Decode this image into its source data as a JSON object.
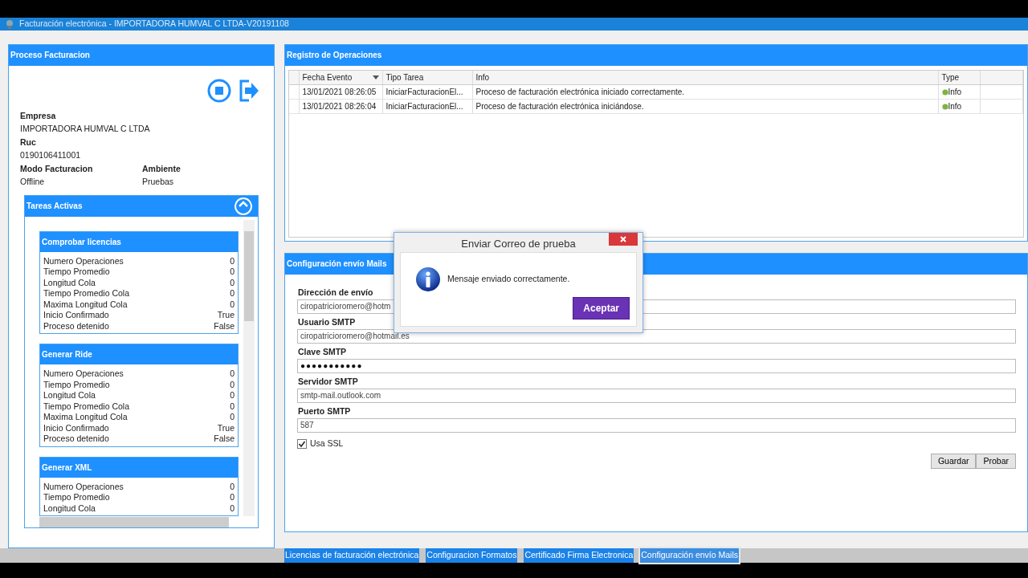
{
  "window": {
    "title": "Facturación electrónica - IMPORTADORA HUMVAL C  LTDA-V20191108"
  },
  "proceso": {
    "title": "Proceso Facturacion",
    "fields": [
      {
        "label": "Empresa",
        "value": "IMPORTADORA HUMVAL C  LTDA"
      },
      {
        "label": "Ruc",
        "value": "0190106411001"
      }
    ],
    "pair_fields": [
      {
        "label": "Modo Facturacion",
        "value": "Offline"
      },
      {
        "label": "Ambiente",
        "value": "Pruebas"
      }
    ],
    "tareas": {
      "title": "Tareas Activas",
      "expanded": true,
      "groups": [
        {
          "title": "Comprobar licencias",
          "rows": [
            {
              "label": "Numero Operaciones",
              "value": "0"
            },
            {
              "label": "Tiempo Promedio",
              "value": "0"
            },
            {
              "label": "Longitud Cola",
              "value": "0"
            },
            {
              "label": "Tiempo Promedio Cola",
              "value": "0"
            },
            {
              "label": "Maxima Longitud Cola",
              "value": "0"
            },
            {
              "label": "Inicio Confirmado",
              "value": "True"
            },
            {
              "label": "Proceso detenido",
              "value": "False"
            }
          ]
        },
        {
          "title": "Generar Ride",
          "rows": [
            {
              "label": "Numero Operaciones",
              "value": "0"
            },
            {
              "label": "Tiempo Promedio",
              "value": "0"
            },
            {
              "label": "Longitud Cola",
              "value": "0"
            },
            {
              "label": "Tiempo Promedio Cola",
              "value": "0"
            },
            {
              "label": "Maxima Longitud Cola",
              "value": "0"
            },
            {
              "label": "Inicio Confirmado",
              "value": "True"
            },
            {
              "label": "Proceso detenido",
              "value": "False"
            }
          ]
        },
        {
          "title": "Generar XML",
          "rows": [
            {
              "label": "Numero Operaciones",
              "value": "0"
            },
            {
              "label": "Tiempo Promedio",
              "value": "0"
            },
            {
              "label": "Longitud Cola",
              "value": "0"
            }
          ]
        }
      ]
    }
  },
  "registro": {
    "title": "Registro de Operaciones",
    "table": {
      "columns": [
        {
          "label": "Fecha Evento",
          "sorted": true
        },
        {
          "label": "Tipo Tarea",
          "sorted": false
        },
        {
          "label": "Info",
          "sorted": false
        },
        {
          "label": "Type",
          "sorted": false
        }
      ],
      "rows": [
        [
          "13/01/2021 08:26:05",
          "IniciarFacturacionEl...",
          "Proceso de facturación electrónica iniciado correctamente.",
          "Info"
        ],
        [
          "13/01/2021 08:26:04",
          "IniciarFacturacionEl...",
          "Proceso de facturación electrónica iniciándose.",
          "Info"
        ]
      ]
    }
  },
  "config": {
    "title": "Configuración envío Mails",
    "fields": [
      {
        "label": "Dirección de envío",
        "value": "ciropatricioromero@hotm",
        "kind": "text"
      },
      {
        "label": "Usuario SMTP",
        "value": "ciropatricioromero@hotmail.es",
        "kind": "text"
      },
      {
        "label": "Clave SMTP",
        "value": "●●●●●●●●●●●",
        "kind": "password"
      },
      {
        "label": "Servidor SMTP",
        "value": "smtp-mail.outlook.com",
        "kind": "text"
      },
      {
        "label": "Puerto SMTP",
        "value": "587",
        "kind": "text"
      }
    ],
    "checkbox": {
      "label": "Usa SSL",
      "checked": true
    },
    "buttons": [
      "Guardar",
      "Probar"
    ]
  },
  "tabs": [
    {
      "label": "Licencias de facturación electrónica",
      "selected": false
    },
    {
      "label": "Configuracion Formatos",
      "selected": false
    },
    {
      "label": "Certificado Firma Electronica",
      "selected": false
    },
    {
      "label": "Configuración envío Mails",
      "selected": true
    }
  ],
  "dialog": {
    "title": "Enviar Correo de prueba",
    "message": "Mensaje enviado correctamente.",
    "button": "Aceptar"
  }
}
